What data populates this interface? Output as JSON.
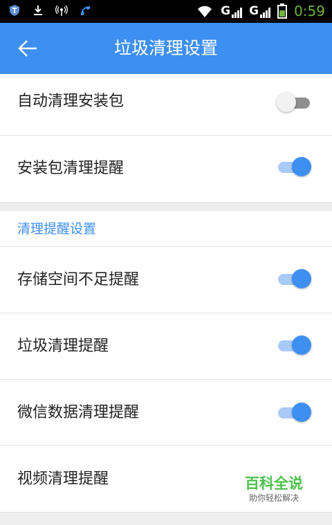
{
  "status_bar": {
    "network_1": "G",
    "network_1_sup": "1",
    "network_2": "G",
    "network_2_sup": "2",
    "time": "0:59"
  },
  "toolbar": {
    "title": "垃圾清理设置"
  },
  "settings": [
    {
      "label": "自动清理安装包",
      "enabled": false
    },
    {
      "label": "安装包清理提醒",
      "enabled": true
    }
  ],
  "reminder_section": {
    "header": "清理提醒设置",
    "items": [
      {
        "label": "存储空间不足提醒",
        "enabled": true
      },
      {
        "label": "垃圾清理提醒",
        "enabled": true
      },
      {
        "label": "微信数据清理提醒",
        "enabled": true
      },
      {
        "label": "视频清理提醒"
      }
    ]
  },
  "watermark": {
    "main": "百科全说",
    "sub": "助你轻松解决"
  },
  "colors": {
    "accent": "#3d8ff2",
    "switch_on_track": "#a9c9f6",
    "switch_off_track": "#8f8f8f",
    "watermark": "#4cc04c",
    "clock": "#6fb33b"
  }
}
